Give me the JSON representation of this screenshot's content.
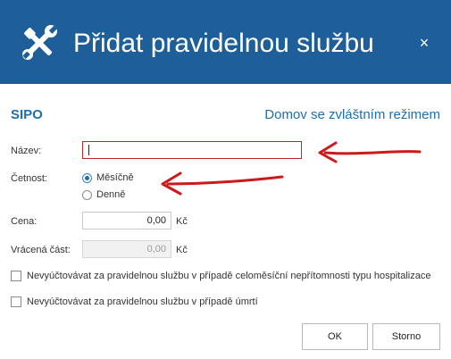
{
  "dialog": {
    "title": "Přidat pravidelnou službu",
    "close_symbol": "×"
  },
  "section": {
    "title": "SIPO",
    "link": "Domov se zvláštním režimem"
  },
  "form": {
    "name_label": "Název:",
    "name_value": "",
    "frequency_label": "Četnost:",
    "frequency_options": [
      {
        "label": "Měsíčně",
        "selected": true
      },
      {
        "label": "Denně",
        "selected": false
      }
    ],
    "price_label": "Cena:",
    "price_value": "0,00",
    "price_unit": "Kč",
    "refund_label": "Vrácená část:",
    "refund_value": "0,00",
    "refund_unit": "Kč",
    "checkbox_hospital": "Nevyúčtovávat za pravidelnou službu v případě celoměsíční nepřítomnosti typu hospitalizace",
    "checkbox_death": "Nevyúčtovávat za pravidelnou službu v případě úmrtí"
  },
  "buttons": {
    "ok": "OK",
    "cancel": "Storno"
  },
  "colors": {
    "header": "#1f5f99",
    "accent": "#1f6fb0",
    "error_border": "#c0282c",
    "annotation_arrow": "#cc1a1a"
  },
  "icons": {
    "header": "tools-icon",
    "close": "close-icon"
  }
}
